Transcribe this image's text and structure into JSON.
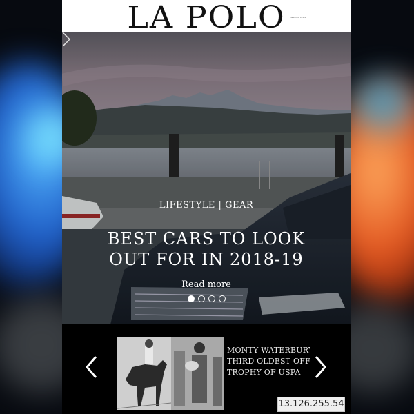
{
  "header": {
    "logo": "LA POLO",
    "logo_small": "LA POLO CLUB"
  },
  "hero": {
    "category": "LIFESTYLE | GEAR",
    "title_line1": "BEST CARS TO LOOK",
    "title_line2": "OUT FOR IN 2018-19",
    "read_more": "Read more",
    "slides_total": 4,
    "active_slide": 1,
    "next_icon": "chevron-right-icon"
  },
  "carousel": {
    "text_line1": "MONTY WATERBURY",
    "text_line2": "THIRD OLDEST OFFIC",
    "text_line3": "TROPHY OF USPA",
    "prev_icon": "chevron-left-icon",
    "next_icon": "chevron-right-icon"
  },
  "overlay": {
    "ip_address": "13.126.255.54"
  }
}
